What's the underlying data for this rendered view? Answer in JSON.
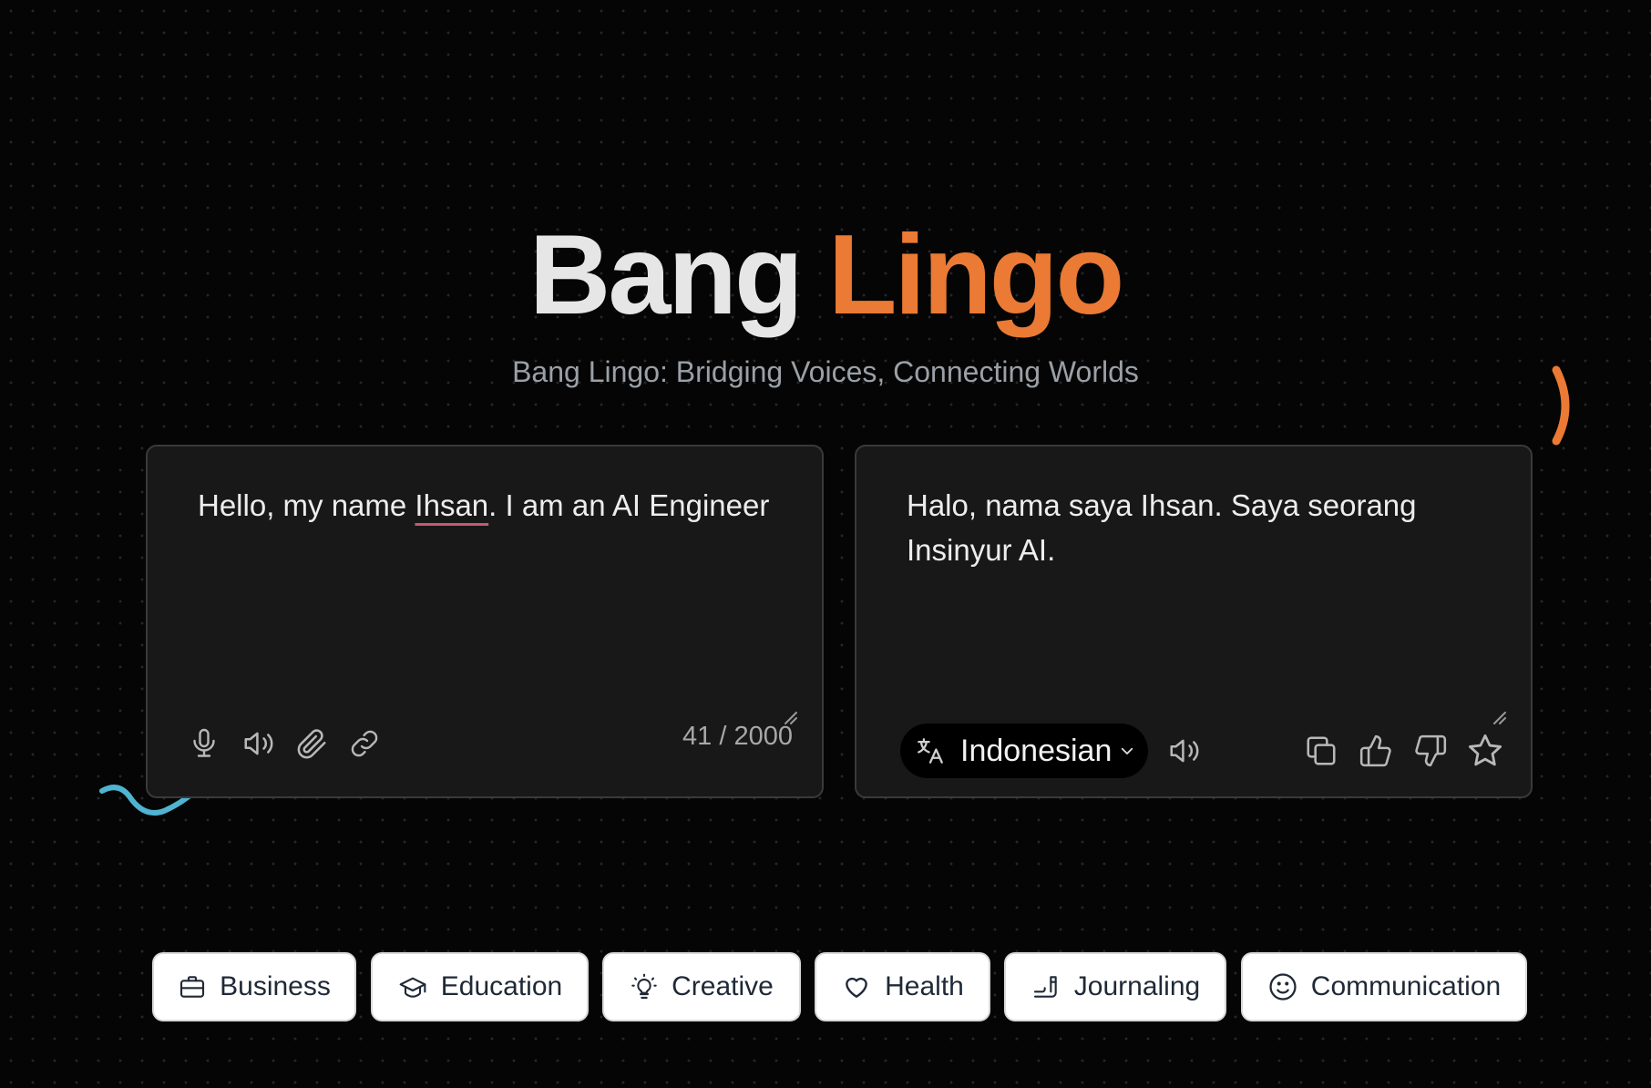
{
  "header": {
    "title_part1": "Bang",
    "title_part2": "Lingo",
    "subtitle": "Bang Lingo: Bridging Voices, Connecting Worlds"
  },
  "colors": {
    "accent_orange": "#ea7a34",
    "accent_blue": "#4fb3d1",
    "background": "#050505",
    "panel": "#181818"
  },
  "source_panel": {
    "text_before": "Hello, my name ",
    "text_flagged": "Ihsan",
    "text_after": ". I am an AI Engineer",
    "char_count": "41 / 2000",
    "tools": [
      "microphone-icon",
      "speaker-icon",
      "paperclip-icon",
      "link-icon"
    ]
  },
  "target_panel": {
    "text": "Halo, nama saya Ihsan. Saya seorang Insinyur AI.",
    "language": "Indonesian",
    "tools": [
      "speaker-icon",
      "copy-icon",
      "thumbs-up-icon",
      "thumbs-down-icon",
      "star-icon"
    ]
  },
  "categories": [
    {
      "label": "Business",
      "icon": "briefcase-icon"
    },
    {
      "label": "Education",
      "icon": "graduation-cap-icon"
    },
    {
      "label": "Creative",
      "icon": "lightbulb-icon"
    },
    {
      "label": "Health",
      "icon": "heart-icon"
    },
    {
      "label": "Journaling",
      "icon": "journaling-icon"
    },
    {
      "label": "Communication",
      "icon": "smile-icon"
    }
  ]
}
